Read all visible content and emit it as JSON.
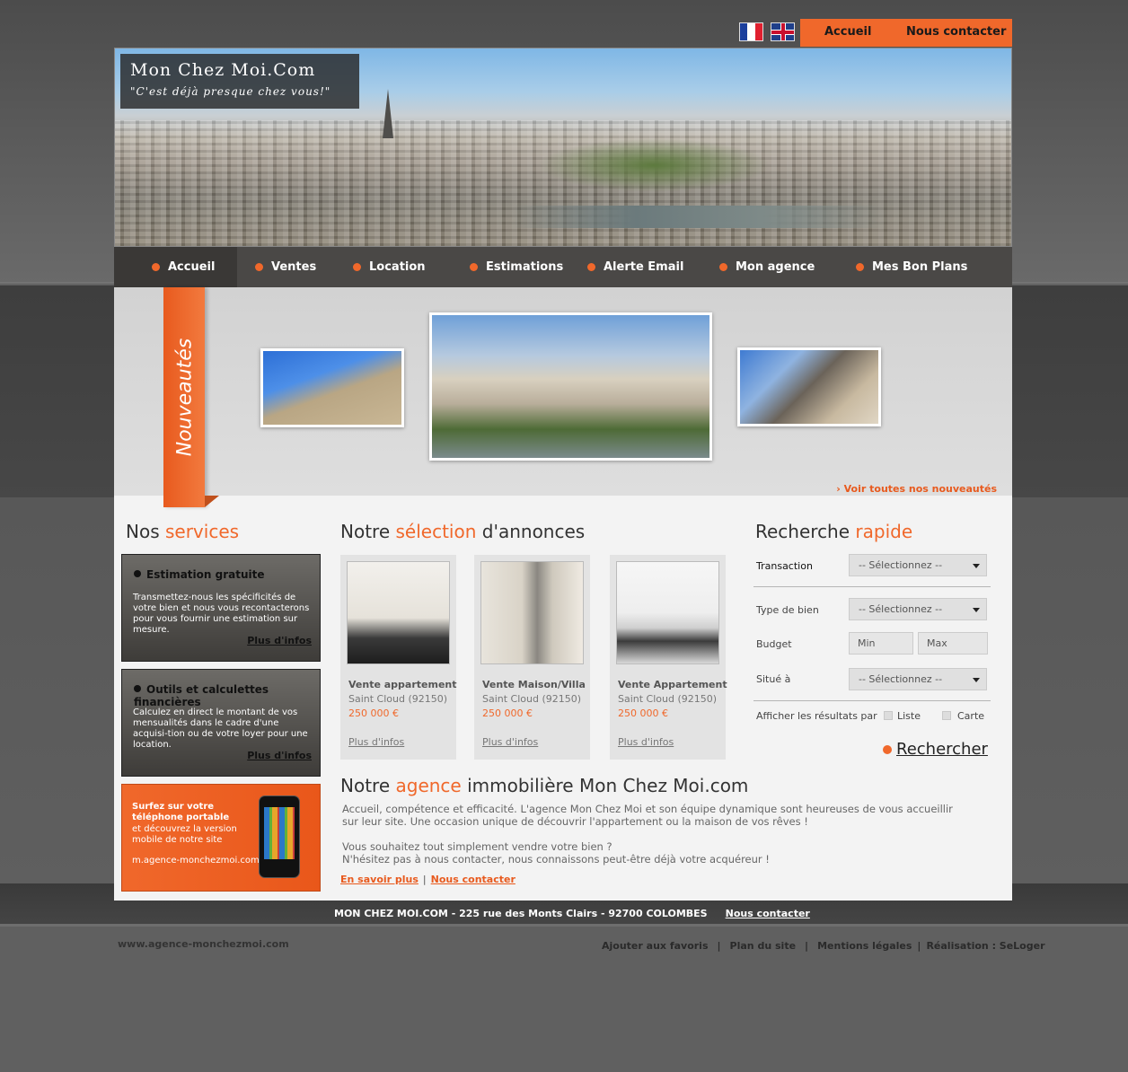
{
  "lang_flags": {
    "fr": "Français",
    "en": "English"
  },
  "topnav": {
    "accueil": "Accueil",
    "contact": "Nous contacter"
  },
  "logo": {
    "title": "Mon Chez Moi.Com",
    "tagline": "\"C'est déjà presque chez vous!\""
  },
  "mainnav": [
    "Accueil",
    "Ventes",
    "Location",
    "Estimations",
    "Alerte Email",
    "Mon agence",
    "Mes Bon Plans"
  ],
  "nouveautes": {
    "label": "Nouveautés",
    "voir_toutes": "› Voir toutes nos nouveautés"
  },
  "services": {
    "heading": "Nos",
    "heading_accent": "services",
    "items": [
      {
        "title": "Estimation gratuite",
        "text": "Transmettez-nous les spécificités de votre bien et nous vous recontacterons pour vous fournir une estimation sur mesure.",
        "more": "Plus d'infos"
      },
      {
        "title": "Outils et calculettes financières",
        "text": "Calculez en direct le montant de vos mensualités dans le cadre d'une acquisi-tion ou de votre loyer pour une location.",
        "more": "Plus d'infos"
      }
    ],
    "mobile": {
      "title": "Surfez sur votre téléphone portable",
      "text": "et découvrez la version mobile de notre site",
      "url": "m.agence-monchezmoi.com"
    }
  },
  "selection": {
    "heading": "Notre",
    "heading_accent": "sélection",
    "heading_end": "d'annonces",
    "cards": [
      {
        "title": "Vente appartement",
        "location": "Saint Cloud  (92150)",
        "price": "250 000 €",
        "more": "Plus d'infos"
      },
      {
        "title": "Vente Maison/Villa",
        "location": "Saint Cloud  (92150)",
        "price": "250 000 €",
        "more": "Plus d'infos"
      },
      {
        "title": "Vente Appartement",
        "location": "Saint Cloud  (92150)",
        "price": "250 000 €",
        "more": "Plus d'infos"
      }
    ]
  },
  "agence": {
    "heading": "Notre",
    "heading_accent": "agence",
    "heading_end": "immobilière Mon Chez Moi.com",
    "p1": "Accueil, compétence et efficacité. L'agence Mon Chez Moi et son équipe dynamique sont heureuses de vous accueillir sur leur site. Une occasion unique de découvrir l'appartement ou la maison de vos rêves !",
    "p2": "Vous souhaitez tout simplement vendre votre bien ?",
    "p3": "N'hésitez pas à nous contacter, nous connaissons peut-être déjà votre acquéreur !",
    "link1": "En savoir plus",
    "link2": "Nous contacter"
  },
  "recherche": {
    "heading": "Recherche",
    "heading_accent": "rapide",
    "transaction": "Transaction",
    "type": "Type de bien",
    "budget": "Budget",
    "situe": "Situé à",
    "select_placeholder": "-- Sélectionnez --",
    "min": "Min",
    "max": "Max",
    "afficher": "Afficher les résultats par",
    "liste": "Liste",
    "carte": "Carte",
    "button": "Rechercher"
  },
  "footer": {
    "address": "MON CHEZ MOI.COM - 225 rue des Monts Clairs - 92700 COLOMBES",
    "contact": "Nous contacter",
    "site": "www.agence-monchezmoi.com",
    "links": [
      "Ajouter aux favoris",
      "Plan du site",
      "Mentions légales",
      "Réalisation : SeLoger"
    ]
  },
  "colors": {
    "accent": "#f0682b",
    "nav": "#4a4846"
  }
}
